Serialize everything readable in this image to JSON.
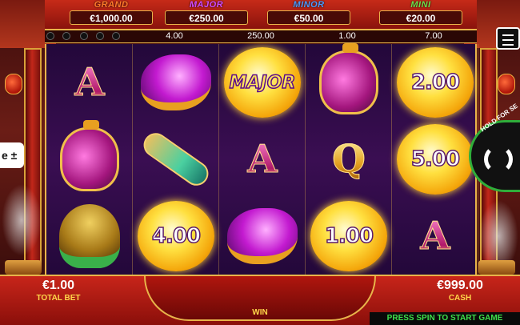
{
  "jackpots": [
    {
      "name": "GRAND",
      "value": "€1,000.00",
      "color": "#ff7a2a"
    },
    {
      "name": "MAJOR",
      "value": "€250.00",
      "color": "#d04aff"
    },
    {
      "name": "MINOR",
      "value": "€50.00",
      "color": "#4a9aff"
    },
    {
      "name": "MINI",
      "value": "€20.00",
      "color": "#6ae04a"
    }
  ],
  "stakes": [
    "4.00",
    "250.00",
    "1.00",
    "7.00"
  ],
  "reels": [
    [
      {
        "kind": "letter",
        "text": "A"
      },
      {
        "kind": "vase"
      },
      {
        "kind": "monkey"
      }
    ],
    [
      {
        "kind": "fish"
      },
      {
        "kind": "ruyi"
      },
      {
        "kind": "coin",
        "text": "4.00"
      }
    ],
    [
      {
        "kind": "coin-label",
        "text": "MAJOR"
      },
      {
        "kind": "letter",
        "text": "A"
      },
      {
        "kind": "fish"
      }
    ],
    [
      {
        "kind": "vase"
      },
      {
        "kind": "letter-q",
        "text": "Q"
      },
      {
        "kind": "coin",
        "text": "1.00"
      }
    ],
    [
      {
        "kind": "coin",
        "text": "2.00"
      },
      {
        "kind": "coin",
        "text": "5.00"
      },
      {
        "kind": "letter",
        "text": "A"
      }
    ]
  ],
  "hold_text": "HOLD FOR SE",
  "left_tab_text": "e ±",
  "total_bet": {
    "amount": "€1.00",
    "label": "TOTAL BET"
  },
  "cash": {
    "amount": "€999.00",
    "label": "CASH"
  },
  "win_label": "WIN",
  "press_spin": "PRESS SPIN TO START GAME"
}
